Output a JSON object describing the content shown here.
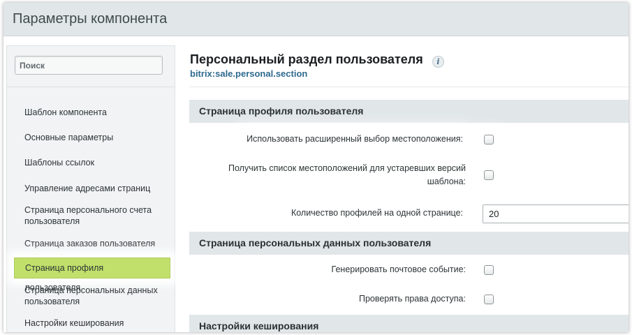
{
  "window": {
    "title": "Параметры компонента"
  },
  "sidebar": {
    "search_placeholder": "Поиск",
    "items": [
      {
        "label": "Шаблон компонента"
      },
      {
        "label": "Основные параметры"
      },
      {
        "label": "Шаблоны ссылок"
      },
      {
        "label": "Управление адресами страниц"
      },
      {
        "label": "Страница персонального счета пользователя"
      },
      {
        "label": "Страница заказов пользователя"
      },
      {
        "label": "Страница профиля пользователя",
        "active": true
      },
      {
        "label": "Страница персональных данных пользователя"
      },
      {
        "label": "Настройки кеширования"
      }
    ]
  },
  "main": {
    "title": "Персональный раздел пользователя",
    "info_icon": "info-icon",
    "component_code": "bitrix:sale.personal.section",
    "sections": [
      {
        "title": "Страница профиля пользователя",
        "params": [
          {
            "label": "Использовать расширенный выбор местоположения:",
            "type": "checkbox",
            "checked": false
          },
          {
            "label": "Получить список местоположений для устаревших версий шаблона:",
            "type": "checkbox",
            "checked": false
          },
          {
            "label": "Количество профилей на одной странице:",
            "type": "text",
            "value": "20"
          }
        ]
      },
      {
        "title": "Страница персональных данных пользователя",
        "params": [
          {
            "label": "Генерировать почтовое событие:",
            "type": "checkbox",
            "checked": false
          },
          {
            "label": "Проверять права доступа:",
            "type": "checkbox",
            "checked": false
          }
        ]
      },
      {
        "title": "Настройки кеширования",
        "params": []
      }
    ]
  },
  "colors": {
    "titlebar_bg": "#e1e6e8",
    "section_header_bg": "#e1e6e9",
    "active_item_bg": "#c0e06b",
    "code_link": "#2f6a8e"
  }
}
